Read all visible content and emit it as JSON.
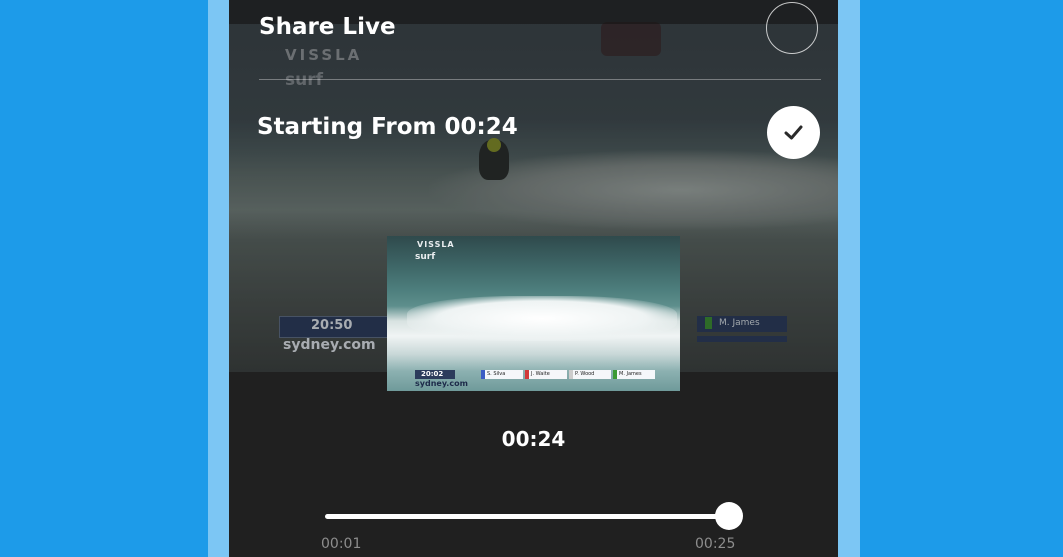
{
  "header": {
    "share_live_label": "Share Live",
    "starting_from_label": "Starting From 00:24"
  },
  "video": {
    "watermark_line1": "VISSLA",
    "watermark_line2": "surf",
    "scoreboard_time": "20:50",
    "scoreboard_site": "sydney.com",
    "scoreboard_athlete": "M. James"
  },
  "preview": {
    "watermark_line1": "VISSLA",
    "watermark_line2": "surf",
    "scoreboard_time": "20:02",
    "scoreboard_site": "sydney.com",
    "athletes": [
      "S. Silva",
      "J. Waite",
      "P. Wood",
      "M. James"
    ],
    "athlete_colors": [
      "#3b5cc4",
      "#d23a3a",
      "#cccccc",
      "#3c9a34"
    ]
  },
  "timeline": {
    "current_time": "00:24",
    "start_time": "00:01",
    "end_time": "00:25",
    "position": 1.0
  },
  "colors": {
    "background": "#1d9be9",
    "device_bezel": "#7cc6f4",
    "screen": "#202020"
  }
}
